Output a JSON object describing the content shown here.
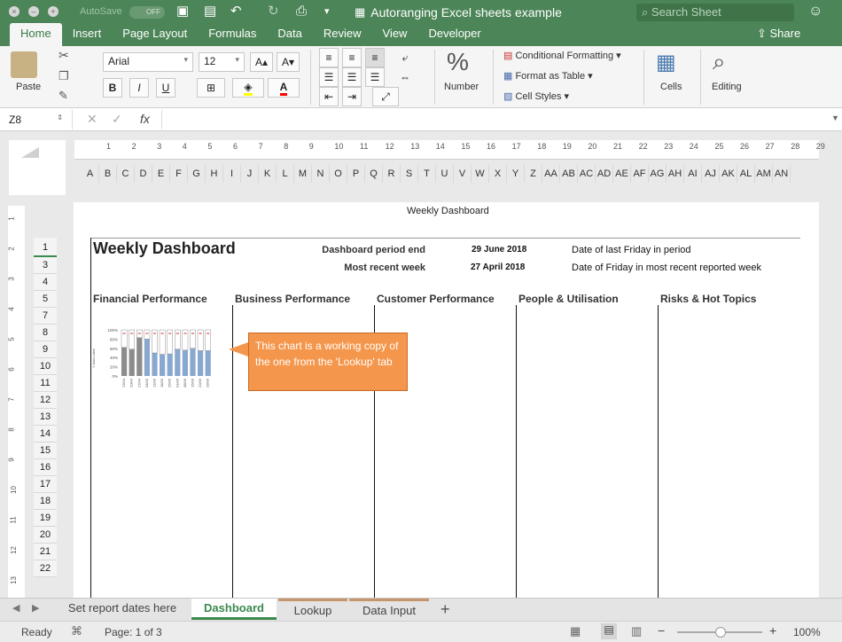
{
  "window": {
    "title": "Autoranging Excel sheets example",
    "autosave_label": "AutoSave",
    "autosave_state": "OFF",
    "search_placeholder": "Search Sheet"
  },
  "tabs": [
    {
      "label": "Home",
      "active": true
    },
    {
      "label": "Insert"
    },
    {
      "label": "Page Layout"
    },
    {
      "label": "Formulas"
    },
    {
      "label": "Data"
    },
    {
      "label": "Review"
    },
    {
      "label": "View"
    },
    {
      "label": "Developer"
    }
  ],
  "share_label": "Share",
  "ribbon": {
    "paste_label": "Paste",
    "font_name": "Arial",
    "font_size": "12",
    "bold": "B",
    "italic": "I",
    "underline": "U",
    "number_symbol": "%",
    "number_label": "Number",
    "conditional_formatting": "Conditional Formatting",
    "format_as_table": "Format as Table",
    "cell_styles": "Cell Styles",
    "cells_label": "Cells",
    "editing_label": "Editing",
    "font_grow": "A",
    "font_shrink": "A",
    "fill_color": "#ffff00",
    "font_color": "#ff0000"
  },
  "formula_bar": {
    "name_box": "Z8",
    "fx": "fx",
    "content": ""
  },
  "ruler_marks": [
    "1",
    "2",
    "3",
    "4",
    "5",
    "6",
    "7",
    "8",
    "9",
    "10",
    "11",
    "12",
    "13",
    "14",
    "15",
    "16",
    "17",
    "18",
    "19",
    "20",
    "21",
    "22",
    "23",
    "24",
    "25",
    "26",
    "27",
    "28",
    "29"
  ],
  "columns": [
    "A",
    "B",
    "C",
    "D",
    "E",
    "F",
    "G",
    "H",
    "I",
    "J",
    "K",
    "L",
    "M",
    "N",
    "O",
    "P",
    "Q",
    "R",
    "S",
    "T",
    "U",
    "V",
    "W",
    "X",
    "Y",
    "Z",
    "AA",
    "AB",
    "AC",
    "AD",
    "AE",
    "AF",
    "AG",
    "AH",
    "AI",
    "AJ",
    "AK",
    "AL",
    "AM",
    "AN"
  ],
  "rows": [
    "1",
    "3",
    "4",
    "5",
    "7",
    "8",
    "9",
    "10",
    "11",
    "12",
    "13",
    "14",
    "15",
    "16",
    "17",
    "18",
    "19",
    "20",
    "21",
    "22"
  ],
  "vruler_marks": [
    "1",
    "2",
    "3",
    "4",
    "5",
    "6",
    "7",
    "8",
    "9",
    "10",
    "11",
    "12",
    "13"
  ],
  "sheet": {
    "page_header": "Weekly Dashboard",
    "title": "Weekly Dashboard",
    "period_end_label": "Dashboard period end",
    "period_end_value": "29 June 2018",
    "period_end_note": "Date of last Friday in period",
    "recent_week_label": "Most recent week",
    "recent_week_value": "27 April 2018",
    "recent_week_note": "Date of Friday in most recent reported week",
    "sections": [
      "Financial Performance",
      "Business Performance",
      "Customer Performance",
      "People & Utilisation",
      "Risks & Hot Topics"
    ],
    "callout": "This chart is a working copy of the one from the 'Lookup' tab"
  },
  "chart_data": {
    "type": "bar",
    "ylabel": "Y Axis Label",
    "ylim": [
      0,
      100
    ],
    "yticks": [
      "100%",
      "80%",
      "60%",
      "40%",
      "20%",
      "0%"
    ],
    "categories": [
      "13/04",
      "20/04",
      "27/04",
      "04/05",
      "11/05",
      "18/05",
      "25/05",
      "01/06",
      "08/06",
      "15/06",
      "22/06",
      "29/06"
    ],
    "series": [
      {
        "values": [
          62,
          58,
          83,
          80,
          50,
          47,
          48,
          58,
          56,
          60,
          55,
          55
        ],
        "color_first": "#8c8c8c",
        "color_rest": "#8aa8cf"
      },
      {
        "values": [
          38,
          42,
          17,
          20,
          50,
          53,
          52,
          42,
          44,
          40,
          45,
          45
        ],
        "color": "#ffffff"
      }
    ]
  },
  "sheet_tabs": [
    {
      "label": "Set report dates here"
    },
    {
      "label": "Dashboard",
      "active": true
    },
    {
      "label": "Lookup"
    },
    {
      "label": "Data Input"
    }
  ],
  "status": {
    "ready": "Ready",
    "page": "Page: 1 of 3",
    "zoom": "100%"
  }
}
